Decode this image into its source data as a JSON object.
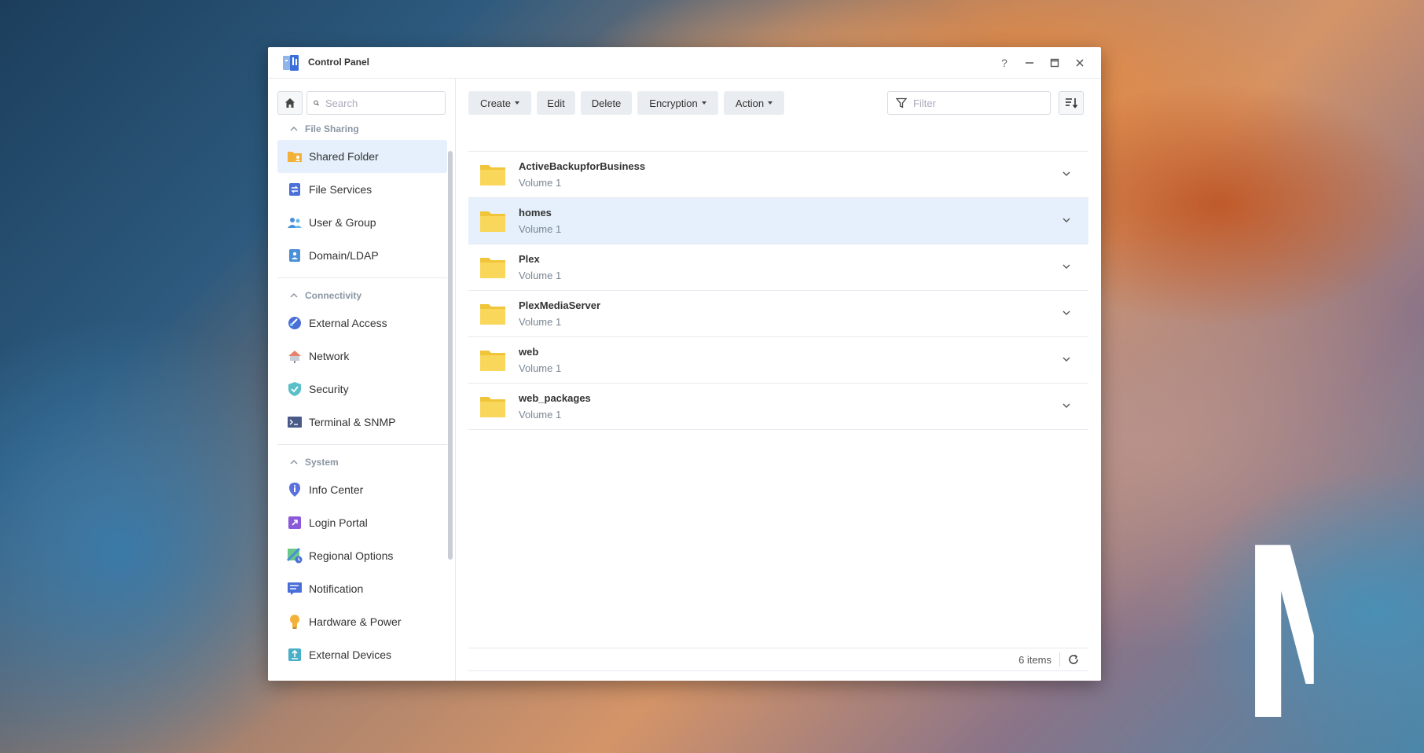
{
  "wallpaper": {
    "logo_text": "M"
  },
  "window": {
    "title": "Control Panel",
    "controls": {
      "help": "?"
    }
  },
  "sidebar": {
    "search_placeholder": "Search",
    "groups": [
      {
        "label": "File Sharing",
        "items": [
          "Shared Folder",
          "File Services",
          "User & Group",
          "Domain/LDAP"
        ]
      },
      {
        "label": "Connectivity",
        "items": [
          "External Access",
          "Network",
          "Security",
          "Terminal & SNMP"
        ]
      },
      {
        "label": "System",
        "items": [
          "Info Center",
          "Login Portal",
          "Regional Options",
          "Notification",
          "Hardware & Power",
          "External Devices"
        ]
      }
    ],
    "active_item": "Shared Folder"
  },
  "toolbar": {
    "create": "Create",
    "edit": "Edit",
    "delete": "Delete",
    "encryption": "Encryption",
    "action": "Action",
    "filter_placeholder": "Filter"
  },
  "folders": [
    {
      "name": "ActiveBackupforBusiness",
      "volume": "Volume 1"
    },
    {
      "name": "homes",
      "volume": "Volume 1"
    },
    {
      "name": "Plex",
      "volume": "Volume 1"
    },
    {
      "name": "PlexMediaServer",
      "volume": "Volume 1"
    },
    {
      "name": "web",
      "volume": "Volume 1"
    },
    {
      "name": "web_packages",
      "volume": "Volume 1"
    }
  ],
  "footer": {
    "count": "6 items"
  },
  "colors": {
    "accent": "#e5f0fc",
    "folder": "#f5cf4f"
  }
}
